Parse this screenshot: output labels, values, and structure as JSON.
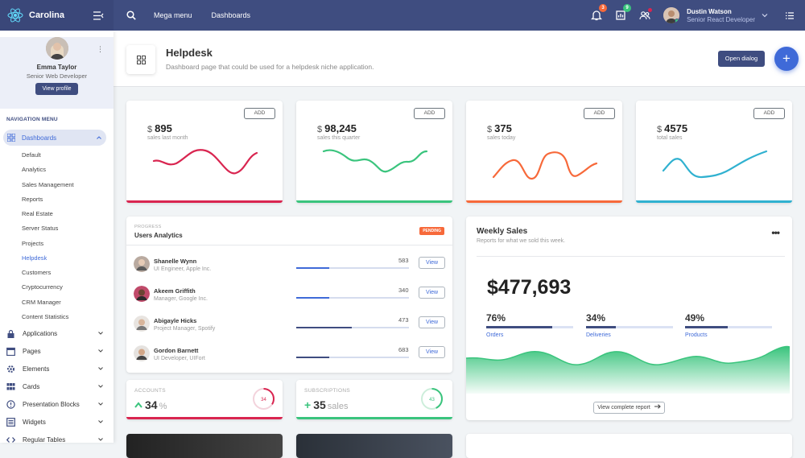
{
  "topbar": {
    "app_name": "Carolina",
    "links": [
      "Mega menu",
      "Dashboards"
    ],
    "notifications_badge": "3",
    "reports_badge": "9",
    "user_name": "Dustin Watson",
    "user_role": "Senior React Developer"
  },
  "sidebar": {
    "user_name": "Emma Taylor",
    "user_role": "Senior Web Developer",
    "view_profile": "View profile",
    "nav_heading": "NAVIGATION MENU",
    "active_section": "Dashboards",
    "dashboard_items": [
      "Default",
      "Analytics",
      "Sales Management",
      "Reports",
      "Real Estate",
      "Server Status",
      "Projects",
      "Helpdesk",
      "Customers",
      "Cryptocurrency",
      "CRM Manager",
      "Content Statistics"
    ],
    "current_item": "Helpdesk",
    "sections": [
      {
        "label": "Applications",
        "icon": "lock-icon"
      },
      {
        "label": "Pages",
        "icon": "calendar-icon"
      },
      {
        "label": "Elements",
        "icon": "gear-icon"
      },
      {
        "label": "Cards",
        "icon": "grid-icon"
      },
      {
        "label": "Presentation Blocks",
        "icon": "info-circle-icon"
      },
      {
        "label": "Widgets",
        "icon": "list-icon"
      },
      {
        "label": "Regular Tables",
        "icon": "code-icon"
      }
    ]
  },
  "page": {
    "title": "Helpdesk",
    "subtitle": "Dashboard page that could be used for a helpdesk niche application.",
    "open_dialog": "Open dialog",
    "fab": "+"
  },
  "stats": [
    {
      "currency": "$",
      "value": "895",
      "label": "sales last month",
      "add": "ADD",
      "color": "#d92550"
    },
    {
      "currency": "$",
      "value": "98,245",
      "label": "sales this quarter",
      "add": "ADD",
      "color": "#3ac47d"
    },
    {
      "currency": "$",
      "value": "375",
      "label": "sales today",
      "add": "ADD",
      "color": "#f7693a"
    },
    {
      "currency": "$",
      "value": "4575",
      "label": "total sales",
      "add": "ADD",
      "color": "#30b1d0"
    }
  ],
  "users_analytics": {
    "pretitle": "PROGRESS",
    "title": "Users Analytics",
    "badge": "PENDING",
    "view_label": "View",
    "rows": [
      {
        "name": "Shanelle Wynn",
        "role": "UI Engineer, Apple Inc.",
        "value": "583",
        "progress": 0.29,
        "color": "#3f6ad8"
      },
      {
        "name": "Akeem Griffith",
        "role": "Manager, Google Inc.",
        "value": "340",
        "progress": 0.29,
        "color": "#3f6ad8"
      },
      {
        "name": "Abigayle Hicks",
        "role": "Project Manager, Spotify",
        "value": "473",
        "progress": 0.49,
        "color": "#3f4d80"
      },
      {
        "name": "Gordon Barnett",
        "role": "UI Developer, UIFort",
        "value": "683",
        "progress": 0.29,
        "color": "#3f4d80"
      }
    ]
  },
  "accounts": {
    "title": "ACCOUNTS",
    "value": "34",
    "unit": "%",
    "ring": "34",
    "ring_fraction": 0.34,
    "color": "#d92550"
  },
  "subscriptions": {
    "title": "SUBSCRIPTIONS",
    "prefix": "+",
    "value": "35",
    "unit": "sales",
    "ring": "43",
    "ring_fraction": 0.43,
    "color": "#3ac47d"
  },
  "weekly_sales": {
    "title": "Weekly Sales",
    "subtitle": "Reports for what we sold this week.",
    "total": "$477,693",
    "metrics": [
      {
        "percent": "76%",
        "label": "Orders",
        "fraction": 0.76,
        "color": "#3f4d80"
      },
      {
        "percent": "34%",
        "label": "Deliveries",
        "fraction": 0.34,
        "color": "#3f4d80"
      },
      {
        "percent": "49%",
        "label": "Products",
        "fraction": 0.49,
        "color": "#3f4d80"
      }
    ],
    "button": "View complete report"
  }
}
